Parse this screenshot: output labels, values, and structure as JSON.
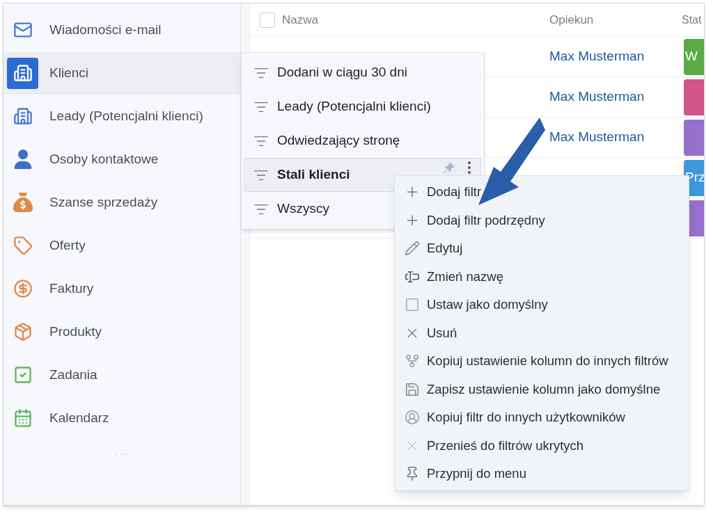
{
  "sidebar": {
    "items": [
      {
        "label": "Wiadomości e-mail",
        "selected": false
      },
      {
        "label": "Klienci",
        "selected": true
      },
      {
        "label": "Leady (Potencjalni klienci)",
        "selected": false
      },
      {
        "label": "Osoby kontaktowe",
        "selected": false
      },
      {
        "label": "Szanse sprzedaży",
        "selected": false
      },
      {
        "label": "Oferty",
        "selected": false
      },
      {
        "label": "Faktury",
        "selected": false
      },
      {
        "label": "Produkty",
        "selected": false
      },
      {
        "label": "Zadania",
        "selected": false
      },
      {
        "label": "Kalendarz",
        "selected": false
      }
    ],
    "more": "···"
  },
  "table": {
    "select_all": {
      "checked": false
    },
    "columns": [
      "Nazwa",
      "Opiekun",
      "Stat"
    ],
    "rows": [
      {
        "owner": "Max Musterman",
        "status": "W",
        "color": "#5aaa46"
      },
      {
        "owner": "Max Musterman",
        "status": "",
        "color": "#d1548a"
      },
      {
        "owner": "Max Musterman",
        "status": "",
        "color": "#9670cc"
      },
      {
        "status": "Prz",
        "color": "#3f97dc"
      },
      {
        "status": "",
        "color": "#9670cc"
      }
    ]
  },
  "filter_list": {
    "items": [
      {
        "label": "Dodani w ciągu 30 dni",
        "selected": false
      },
      {
        "label": "Leady (Potencjalni klienci)",
        "selected": false
      },
      {
        "label": "Odwiedzający stronę",
        "selected": false
      },
      {
        "label": "Stali klienci",
        "selected": true
      },
      {
        "label": "Wszyscy",
        "selected": false
      }
    ]
  },
  "context_menu": {
    "items": [
      {
        "label": "Dodaj filtr"
      },
      {
        "label": "Dodaj filtr podrzędny"
      },
      {
        "label": "Edytuj"
      },
      {
        "label": "Zmień nazwę"
      },
      {
        "label": "Ustaw jako domyślny"
      },
      {
        "label": "Usuń"
      },
      {
        "label": "Kopiuj ustawienie kolumn do innych filtrów"
      },
      {
        "label": "Zapisz ustawienie kolumn jako domyślne"
      },
      {
        "label": "Kopiuj filtr do innych użytkowników"
      },
      {
        "label": "Przenieś do filtrów ukrytych"
      },
      {
        "label": "Przypnij do menu"
      }
    ]
  }
}
